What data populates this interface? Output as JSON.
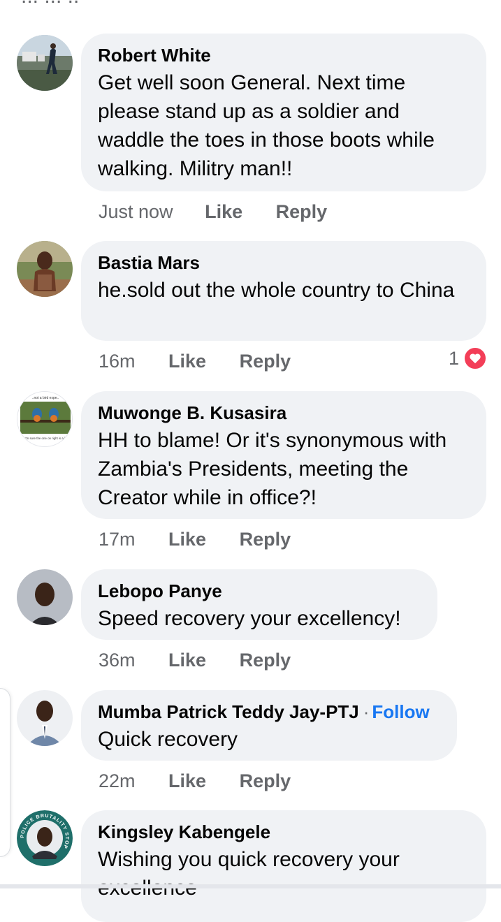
{
  "top_clip_text": "... ... ..",
  "comments": [
    {
      "author": "Robert White",
      "text": "Get well soon General.   Next time please stand up as a soldier and waddle the toes in those boots while walking.   Militry man!!",
      "time": "Just now",
      "like_label": "Like",
      "reply_label": "Reply"
    },
    {
      "author": "Bastia Mars",
      "text": "he.sold out the whole country to China",
      "time": "16m",
      "like_label": "Like",
      "reply_label": "Reply",
      "reaction_count": "1"
    },
    {
      "author": "Muwonge B. Kusasira",
      "text": "HH to blame! Or it's synonymous with Zambia's Presidents, meeting the Creator while in office?!",
      "time": "17m",
      "like_label": "Like",
      "reply_label": "Reply",
      "avatar_text_top": "..not a bird expe..",
      "avatar_text_bottom": "...ut I'm sure the one on right is a fem..."
    },
    {
      "author": "Lebopo Panye",
      "text": "Speed recovery your excellency!",
      "time": "36m",
      "like_label": "Like",
      "reply_label": "Reply"
    },
    {
      "author": "Mumba Patrick Teddy Jay-PTJ",
      "separator": "·",
      "follow_label": "Follow",
      "text": "Quick recovery",
      "time": "22m",
      "like_label": "Like",
      "reply_label": "Reply"
    },
    {
      "author": "Kingsley Kabengele",
      "text": "Wishing you quick recovery your excellence",
      "avatar_ring_text": "POLICE BRUTALITY STOP"
    }
  ],
  "colors": {
    "bubble_bg": "#f0f2f5",
    "meta_text": "#65676b",
    "follow_link": "#1877f2",
    "heart": "#f33e58"
  },
  "icons": [
    "heart-reaction-icon"
  ]
}
